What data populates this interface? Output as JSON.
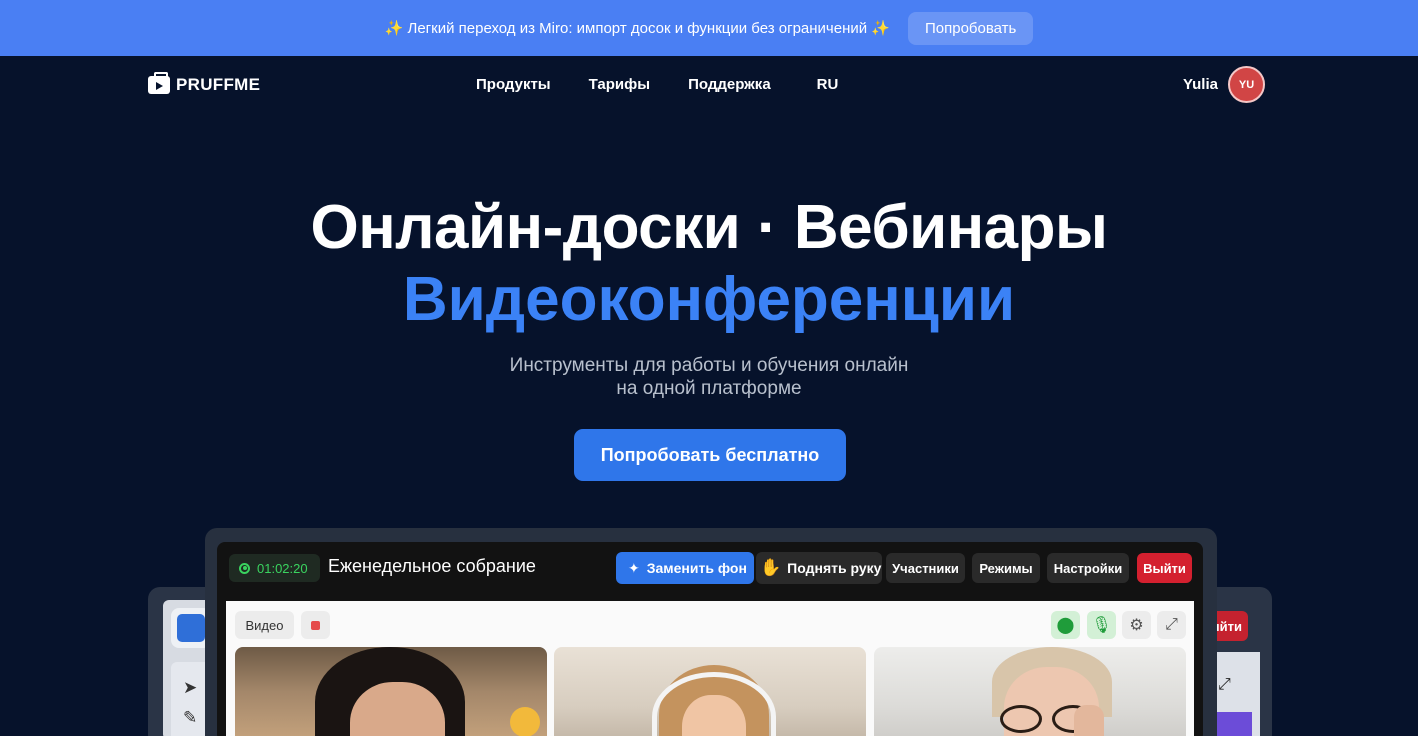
{
  "promo": {
    "sparkle_left": "✨",
    "text": "Легкий переход из Miro: импорт досок и функции без ограничений",
    "sparkle_right": "✨",
    "button": "Попробовать"
  },
  "nav": {
    "logo": "PRUFFME",
    "items": [
      "Продукты",
      "Тарифы",
      "Поддержка",
      "RU"
    ],
    "user_name": "Yulia",
    "avatar_initials": "YU"
  },
  "hero": {
    "title_line1": "Онлайн-доски · Вебинары",
    "title_line2": "Видеоконференции",
    "subtitle_line1": "Инструменты для работы и обучения онлайн",
    "subtitle_line2": "на одной платформе",
    "cta": "Попробовать бесплатно"
  },
  "conference": {
    "timer": "01:02:20",
    "title": "Еженедельное собрание",
    "buttons": {
      "replace_bg": "Заменить фон",
      "raise_hand": "Поднять руку",
      "participants": "Участники",
      "modes": "Режимы",
      "settings": "Настройки",
      "exit": "Выйти"
    },
    "video_tab": "Видео",
    "back_exit": "Выйти"
  },
  "colors": {
    "background": "#06122b",
    "promo": "#4a7ff3",
    "accent": "#2f76ea",
    "heading_accent": "#3b82f6",
    "exit": "#d4202f"
  }
}
